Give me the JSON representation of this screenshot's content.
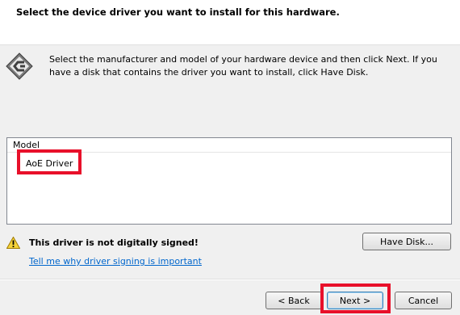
{
  "header": {
    "title": "Select the device driver you want to install for this hardware."
  },
  "instructions": {
    "text": "Select the manufacturer and model of your hardware device and then click Next. If you have a disk that contains the driver you want to install, click Have Disk."
  },
  "model_list": {
    "column_header": "Model",
    "items": [
      {
        "label": "AoE Driver"
      }
    ]
  },
  "warning": {
    "text": "This driver is not digitally signed!",
    "link": "Tell me why driver signing is important"
  },
  "buttons": {
    "have_disk": "Have Disk...",
    "back": "< Back",
    "next": "Next >",
    "cancel": "Cancel"
  },
  "colors": {
    "highlight": "#e8102a",
    "link": "#0066cc",
    "background": "#f0f0f0"
  },
  "icons": [
    "wizard-icon",
    "warning-icon"
  ]
}
